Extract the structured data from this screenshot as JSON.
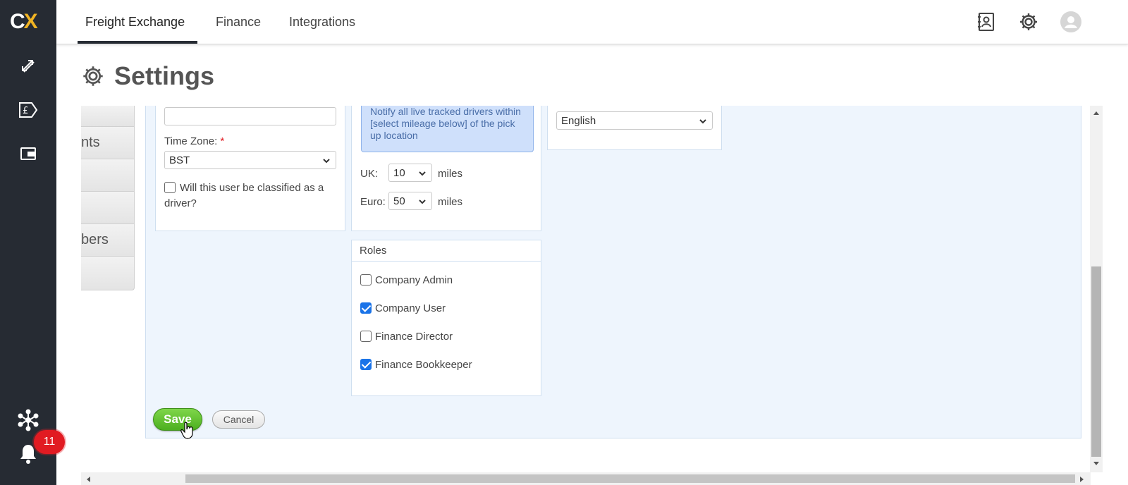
{
  "app": {
    "logo_text_a": "C",
    "logo_text_b": "X"
  },
  "nav": {
    "tabs": [
      {
        "label": "Freight Exchange",
        "active": true
      },
      {
        "label": "Finance",
        "active": false
      },
      {
        "label": "Integrations",
        "active": false
      }
    ]
  },
  "rail": {
    "icons": [
      "exchange-icon",
      "finance-icon",
      "wallet-icon",
      "network-icon",
      "bell-icon"
    ],
    "notification_count": "11"
  },
  "header": {
    "title": "Settings"
  },
  "left_tabs": [
    "",
    "nts",
    "",
    "",
    "bers",
    ""
  ],
  "user_form": {
    "time_zone_label": "Time Zone:",
    "required_mark": "*",
    "time_zone_value": "BST",
    "driver_question": "Will this user be classified as a driver?",
    "driver_checked": false
  },
  "tracking": {
    "info_text": "Notify all live tracked drivers within [select mileage below] of the pick up location",
    "uk_label": "UK:",
    "uk_value": "10",
    "euro_label": "Euro:",
    "euro_value": "50",
    "unit": "miles"
  },
  "language": {
    "value": "English"
  },
  "roles": {
    "title": "Roles",
    "items": [
      {
        "label": "Company Admin",
        "checked": false
      },
      {
        "label": "Company User",
        "checked": true
      },
      {
        "label": "Finance Director",
        "checked": false
      },
      {
        "label": "Finance Bookkeeper",
        "checked": true
      }
    ]
  },
  "actions": {
    "save_label": "Save",
    "cancel_label": "Cancel"
  },
  "colors": {
    "rail_bg": "#262b33",
    "accent": "#f0b323",
    "save_green": "#4caf1f",
    "badge_red": "#e11b22",
    "panel_bg": "#eef5fd"
  }
}
